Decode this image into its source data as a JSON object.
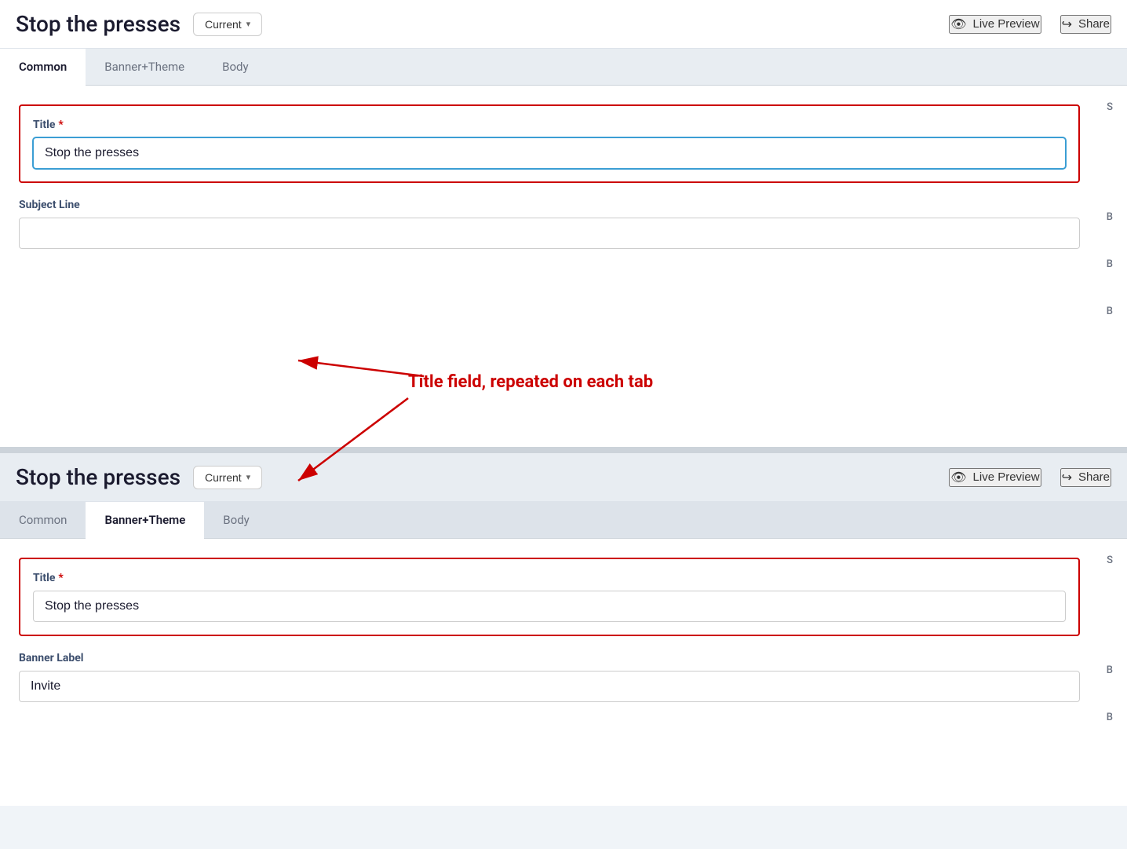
{
  "app": {
    "title": "Stop the presses"
  },
  "header1": {
    "title": "Stop the presses",
    "current_label": "Current",
    "live_preview_label": "Live Preview",
    "share_label": "Share"
  },
  "header2": {
    "title": "Stop the presses",
    "current_label": "Current",
    "live_preview_label": "Live Preview",
    "share_label": "Share"
  },
  "tabs1": {
    "items": [
      {
        "label": "Common",
        "active": true
      },
      {
        "label": "Banner+Theme",
        "active": false
      },
      {
        "label": "Body",
        "active": false
      }
    ]
  },
  "tabs2": {
    "items": [
      {
        "label": "Common",
        "active": false
      },
      {
        "label": "Banner+Theme",
        "active": true
      },
      {
        "label": "Body",
        "active": false
      }
    ]
  },
  "form1": {
    "title_label": "Title",
    "title_value": "Stop the presses",
    "title_placeholder": "",
    "subject_line_label": "Subject Line",
    "subject_line_value": "",
    "subject_line_placeholder": ""
  },
  "form2": {
    "title_label": "Title",
    "title_value": "Stop the presses",
    "title_placeholder": "",
    "banner_label_label": "Banner Label",
    "banner_label_value": "Invite",
    "banner_label_placeholder": ""
  },
  "annotation": {
    "text": "Title field, repeated on each tab"
  },
  "side_labels": {
    "s": "S",
    "b1": "B",
    "b2": "B",
    "b3": "B"
  }
}
